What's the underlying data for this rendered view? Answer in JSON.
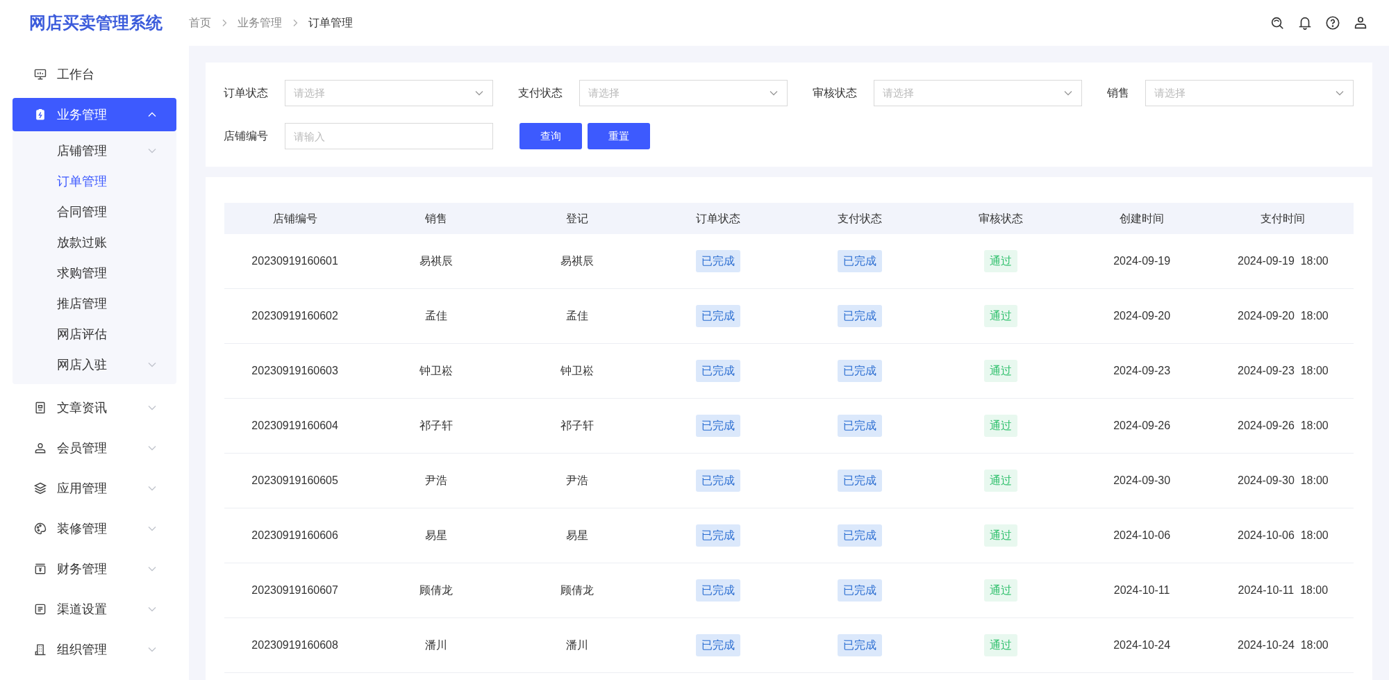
{
  "app_title": "网店买卖管理系统",
  "breadcrumb": [
    "首页",
    "业务管理",
    "订单管理"
  ],
  "sidebar": {
    "items": [
      {
        "label": "工作台",
        "kind": "link",
        "selected": false
      },
      {
        "label": "业务管理",
        "kind": "group",
        "selected": true,
        "expanded": true,
        "children": [
          {
            "label": "店铺管理",
            "kind": "group",
            "selected": false,
            "expanded": false
          },
          {
            "label": "订单管理",
            "kind": "link",
            "selected": true
          },
          {
            "label": "合同管理",
            "kind": "link",
            "selected": false
          },
          {
            "label": "放款过账",
            "kind": "link",
            "selected": false
          },
          {
            "label": "求购管理",
            "kind": "link",
            "selected": false
          },
          {
            "label": "推店管理",
            "kind": "link",
            "selected": false
          },
          {
            "label": "网店评估",
            "kind": "link",
            "selected": false
          },
          {
            "label": "网店入驻",
            "kind": "group",
            "selected": false,
            "expanded": false
          }
        ]
      },
      {
        "label": "文章资讯",
        "kind": "group",
        "selected": false,
        "expanded": false
      },
      {
        "label": "会员管理",
        "kind": "group",
        "selected": false,
        "expanded": false
      },
      {
        "label": "应用管理",
        "kind": "group",
        "selected": false,
        "expanded": false
      },
      {
        "label": "装修管理",
        "kind": "group",
        "selected": false,
        "expanded": false
      },
      {
        "label": "财务管理",
        "kind": "group",
        "selected": false,
        "expanded": false
      },
      {
        "label": "渠道设置",
        "kind": "group",
        "selected": false,
        "expanded": false
      },
      {
        "label": "组织管理",
        "kind": "group",
        "selected": false,
        "expanded": false
      }
    ]
  },
  "filters": [
    {
      "label": "订单状态",
      "kind": "select",
      "placeholder": "请选择"
    },
    {
      "label": "支付状态",
      "kind": "select",
      "placeholder": "请选择"
    },
    {
      "label": "审核状态",
      "kind": "select",
      "placeholder": "请选择"
    },
    {
      "label": "销售",
      "kind": "select",
      "placeholder": "请选择"
    },
    {
      "label": "店铺编号",
      "kind": "input",
      "placeholder": "请输入"
    }
  ],
  "buttons": [
    "查询",
    "重置"
  ],
  "table": {
    "columns": [
      {
        "label": "店铺编号",
        "kind": "text"
      },
      {
        "label": "销售",
        "kind": "text"
      },
      {
        "label": "登记",
        "kind": "text"
      },
      {
        "label": "订单状态",
        "kind": "info"
      },
      {
        "label": "支付状态",
        "kind": "info"
      },
      {
        "label": "审核状态",
        "kind": "success"
      },
      {
        "label": "创建时间",
        "kind": "text"
      },
      {
        "label": "支付时间",
        "kind": "text"
      }
    ],
    "rows": [
      [
        "20230919160601",
        "易祺辰",
        "易祺辰",
        "已完成",
        "已完成",
        "通过",
        "2024-09-19",
        "2024-09-19  18:00"
      ],
      [
        "20230919160602",
        "孟佳",
        "孟佳",
        "已完成",
        "已完成",
        "通过",
        "2024-09-20",
        "2024-09-20  18:00"
      ],
      [
        "20230919160603",
        "钟卫崧",
        "钟卫崧",
        "已完成",
        "已完成",
        "通过",
        "2024-09-23",
        "2024-09-23  18:00"
      ],
      [
        "20230919160604",
        "祁子轩",
        "祁子轩",
        "已完成",
        "已完成",
        "通过",
        "2024-09-26",
        "2024-09-26  18:00"
      ],
      [
        "20230919160605",
        "尹浩",
        "尹浩",
        "已完成",
        "已完成",
        "通过",
        "2024-09-30",
        "2024-09-30  18:00"
      ],
      [
        "20230919160606",
        "易星",
        "易星",
        "已完成",
        "已完成",
        "通过",
        "2024-10-06",
        "2024-10-06  18:00"
      ],
      [
        "20230919160607",
        "顾倩龙",
        "顾倩龙",
        "已完成",
        "已完成",
        "通过",
        "2024-10-11",
        "2024-10-11  18:00"
      ],
      [
        "20230919160608",
        "潘川",
        "潘川",
        "已完成",
        "已完成",
        "通过",
        "2024-10-24",
        "2024-10-24  18:00"
      ]
    ]
  }
}
